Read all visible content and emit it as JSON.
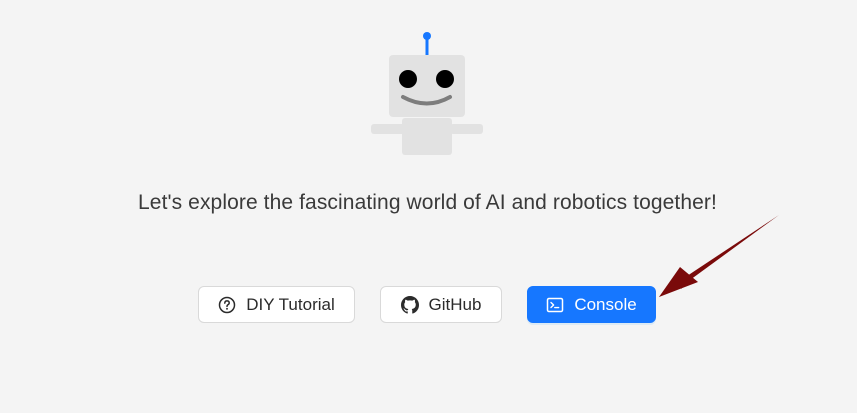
{
  "tagline": "Let's explore the fascinating world of AI and robotics together!",
  "buttons": {
    "tutorial": {
      "label": "DIY Tutorial",
      "icon": "question-circle-icon"
    },
    "github": {
      "label": "GitHub",
      "icon": "github-icon"
    },
    "console": {
      "label": "Console",
      "icon": "terminal-icon"
    }
  },
  "colors": {
    "background": "#f4f4f4",
    "primary": "#1677ff",
    "robot_body": "#e2e2e2",
    "robot_antenna": "#1677ff",
    "annotation_arrow": "#7a0a0a"
  }
}
